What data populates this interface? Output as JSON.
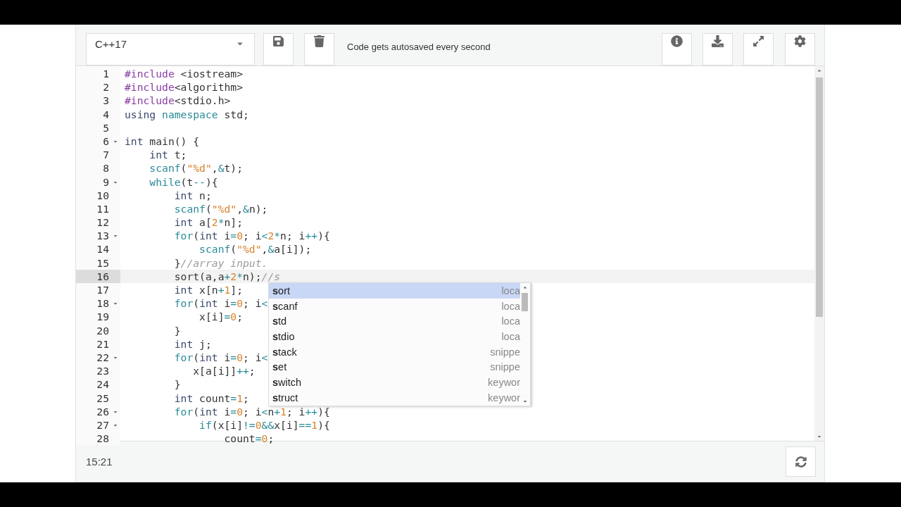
{
  "toolbar": {
    "language": "C++17",
    "note": "Code gets autosaved every second"
  },
  "editor": {
    "lines": [
      {
        "no": "1",
        "fold": false,
        "active": false,
        "tokens": [
          {
            "kind": "pre",
            "text": "#include"
          },
          {
            "kind": "tx",
            "text": " <iostream>"
          }
        ]
      },
      {
        "no": "2",
        "fold": false,
        "active": false,
        "tokens": [
          {
            "kind": "pre",
            "text": "#include"
          },
          {
            "kind": "tx",
            "text": "<algorithm>"
          }
        ]
      },
      {
        "no": "3",
        "fold": false,
        "active": false,
        "tokens": [
          {
            "kind": "pre",
            "text": "#include"
          },
          {
            "kind": "tx",
            "text": "<stdio.h>"
          }
        ]
      },
      {
        "no": "4",
        "fold": false,
        "active": false,
        "tokens": [
          {
            "kind": "kw",
            "text": "using"
          },
          {
            "kind": "fn",
            "text": " namespace"
          },
          {
            "kind": "tx",
            "text": " std;"
          }
        ]
      },
      {
        "no": "5",
        "fold": false,
        "active": false
      },
      {
        "no": "6",
        "fold": true,
        "active": false,
        "tokens": [
          {
            "kind": "kw",
            "text": "int"
          },
          {
            "kind": "tx",
            "text": " main() {"
          }
        ]
      },
      {
        "no": "7",
        "fold": false,
        "active": false,
        "tokens": [
          {
            "kind": "kw",
            "text": "    int"
          },
          {
            "kind": "tx",
            "text": " t;"
          }
        ]
      },
      {
        "no": "8",
        "fold": false,
        "active": false,
        "tokens": [
          {
            "kind": "fn",
            "text": "    scanf"
          },
          {
            "kind": "tx",
            "text": "("
          },
          {
            "kind": "str",
            "text": "\"%d\""
          },
          {
            "kind": "tx",
            "text": ","
          },
          {
            "kind": "op",
            "text": "&"
          },
          {
            "kind": "tx",
            "text": "t);"
          }
        ]
      },
      {
        "no": "9",
        "fold": true,
        "active": false,
        "tokens": [
          {
            "kind": "fn",
            "text": "    while"
          },
          {
            "kind": "tx",
            "text": "(t"
          },
          {
            "kind": "op",
            "text": "--"
          },
          {
            "kind": "tx",
            "text": "){"
          }
        ]
      },
      {
        "no": "10",
        "fold": false,
        "active": false,
        "tokens": [
          {
            "kind": "kw",
            "text": "        int"
          },
          {
            "kind": "tx",
            "text": " n;"
          }
        ]
      },
      {
        "no": "11",
        "fold": false,
        "active": false,
        "tokens": [
          {
            "kind": "fn",
            "text": "        scanf"
          },
          {
            "kind": "tx",
            "text": "("
          },
          {
            "kind": "str",
            "text": "\"%d\""
          },
          {
            "kind": "tx",
            "text": ","
          },
          {
            "kind": "op",
            "text": "&"
          },
          {
            "kind": "tx",
            "text": "n);"
          }
        ]
      },
      {
        "no": "12",
        "fold": false,
        "active": false,
        "tokens": [
          {
            "kind": "kw",
            "text": "        int"
          },
          {
            "kind": "tx",
            "text": " a["
          },
          {
            "kind": "num",
            "text": "2"
          },
          {
            "kind": "op",
            "text": "*"
          },
          {
            "kind": "tx",
            "text": "n];"
          }
        ]
      },
      {
        "no": "13",
        "fold": true,
        "active": false,
        "tokens": [
          {
            "kind": "fn",
            "text": "        for"
          },
          {
            "kind": "tx",
            "text": "("
          },
          {
            "kind": "kw",
            "text": "int"
          },
          {
            "kind": "tx",
            "text": " i"
          },
          {
            "kind": "op",
            "text": "="
          },
          {
            "kind": "num",
            "text": "0"
          },
          {
            "kind": "tx",
            "text": "; i"
          },
          {
            "kind": "op",
            "text": "<"
          },
          {
            "kind": "num",
            "text": "2"
          },
          {
            "kind": "op",
            "text": "*"
          },
          {
            "kind": "tx",
            "text": "n; i"
          },
          {
            "kind": "op",
            "text": "++"
          },
          {
            "kind": "tx",
            "text": "){"
          }
        ]
      },
      {
        "no": "14",
        "fold": false,
        "active": false,
        "tokens": [
          {
            "kind": "fn",
            "text": "            scanf"
          },
          {
            "kind": "tx",
            "text": "("
          },
          {
            "kind": "str",
            "text": "\"%d\""
          },
          {
            "kind": "tx",
            "text": ","
          },
          {
            "kind": "op",
            "text": "&"
          },
          {
            "kind": "tx",
            "text": "a[i]);"
          }
        ]
      },
      {
        "no": "15",
        "fold": false,
        "active": false,
        "tokens": [
          {
            "kind": "tx",
            "text": "        }"
          },
          {
            "kind": "cm",
            "text": "//array input."
          }
        ]
      },
      {
        "no": "16",
        "fold": false,
        "active": true,
        "tokens": [
          {
            "kind": "tx",
            "text": "        sort(a,a"
          },
          {
            "kind": "op",
            "text": "+"
          },
          {
            "kind": "num",
            "text": "2"
          },
          {
            "kind": "op",
            "text": "*"
          },
          {
            "kind": "tx",
            "text": "n);"
          },
          {
            "kind": "cm",
            "text": "//s"
          }
        ]
      },
      {
        "no": "17",
        "fold": false,
        "active": false,
        "tokens": [
          {
            "kind": "kw",
            "text": "        int"
          },
          {
            "kind": "tx",
            "text": " x[n"
          },
          {
            "kind": "op",
            "text": "+"
          },
          {
            "kind": "num",
            "text": "1"
          },
          {
            "kind": "tx",
            "text": "];"
          }
        ]
      },
      {
        "no": "18",
        "fold": true,
        "active": false,
        "tokens": [
          {
            "kind": "fn",
            "text": "        for"
          },
          {
            "kind": "tx",
            "text": "("
          },
          {
            "kind": "kw",
            "text": "int"
          },
          {
            "kind": "tx",
            "text": " i"
          },
          {
            "kind": "op",
            "text": "="
          },
          {
            "kind": "num",
            "text": "0"
          },
          {
            "kind": "tx",
            "text": "; i"
          },
          {
            "kind": "op",
            "text": "<"
          }
        ]
      },
      {
        "no": "19",
        "fold": false,
        "active": false,
        "tokens": [
          {
            "kind": "tx",
            "text": "            x[i]"
          },
          {
            "kind": "op",
            "text": "="
          },
          {
            "kind": "num",
            "text": "0"
          },
          {
            "kind": "tx",
            "text": ";"
          }
        ]
      },
      {
        "no": "20",
        "fold": false,
        "active": false,
        "tokens": [
          {
            "kind": "tx",
            "text": "        }"
          }
        ]
      },
      {
        "no": "21",
        "fold": false,
        "active": false,
        "tokens": [
          {
            "kind": "kw",
            "text": "        int"
          },
          {
            "kind": "tx",
            "text": " j;"
          }
        ]
      },
      {
        "no": "22",
        "fold": true,
        "active": false,
        "tokens": [
          {
            "kind": "fn",
            "text": "        for"
          },
          {
            "kind": "tx",
            "text": "("
          },
          {
            "kind": "kw",
            "text": "int"
          },
          {
            "kind": "tx",
            "text": " i"
          },
          {
            "kind": "op",
            "text": "="
          },
          {
            "kind": "num",
            "text": "0"
          },
          {
            "kind": "tx",
            "text": "; i"
          },
          {
            "kind": "op",
            "text": "<"
          }
        ]
      },
      {
        "no": "23",
        "fold": false,
        "active": false,
        "tokens": [
          {
            "kind": "tx",
            "text": "           x[a[i]]"
          },
          {
            "kind": "op",
            "text": "++"
          },
          {
            "kind": "tx",
            "text": ";"
          }
        ]
      },
      {
        "no": "24",
        "fold": false,
        "active": false,
        "tokens": [
          {
            "kind": "tx",
            "text": "        }"
          }
        ]
      },
      {
        "no": "25",
        "fold": false,
        "active": false,
        "tokens": [
          {
            "kind": "kw",
            "text": "        int"
          },
          {
            "kind": "tx",
            "text": " count"
          },
          {
            "kind": "op",
            "text": "="
          },
          {
            "kind": "num",
            "text": "1"
          },
          {
            "kind": "tx",
            "text": ";"
          }
        ]
      },
      {
        "no": "26",
        "fold": true,
        "active": false,
        "tokens": [
          {
            "kind": "fn",
            "text": "        for"
          },
          {
            "kind": "tx",
            "text": "("
          },
          {
            "kind": "kw",
            "text": "int"
          },
          {
            "kind": "tx",
            "text": " i"
          },
          {
            "kind": "op",
            "text": "="
          },
          {
            "kind": "num",
            "text": "0"
          },
          {
            "kind": "tx",
            "text": "; i"
          },
          {
            "kind": "op",
            "text": "<"
          },
          {
            "kind": "tx",
            "text": "n"
          },
          {
            "kind": "op",
            "text": "+"
          },
          {
            "kind": "num",
            "text": "1"
          },
          {
            "kind": "tx",
            "text": "; i"
          },
          {
            "kind": "op",
            "text": "++"
          },
          {
            "kind": "tx",
            "text": "){"
          }
        ]
      },
      {
        "no": "27",
        "fold": true,
        "active": false,
        "tokens": [
          {
            "kind": "fn",
            "text": "            if"
          },
          {
            "kind": "tx",
            "text": "(x[i]"
          },
          {
            "kind": "op",
            "text": "!="
          },
          {
            "kind": "num",
            "text": "0"
          },
          {
            "kind": "op",
            "text": "&&"
          },
          {
            "kind": "tx",
            "text": "x[i]"
          },
          {
            "kind": "op",
            "text": "=="
          },
          {
            "kind": "num",
            "text": "1"
          },
          {
            "kind": "tx",
            "text": "){"
          }
        ]
      },
      {
        "no": "28",
        "fold": false,
        "active": false,
        "tokens": [
          {
            "kind": "tx",
            "text": "                count"
          },
          {
            "kind": "op",
            "text": "="
          },
          {
            "kind": "num",
            "text": "0"
          },
          {
            "kind": "tx",
            "text": ";"
          }
        ]
      }
    ]
  },
  "autocomplete": [
    {
      "label": "**s**ort",
      "meta": "loca",
      "selected": true
    },
    {
      "label": "**s**canf",
      "meta": "loca",
      "selected": false
    },
    {
      "label": "**s**td",
      "meta": "loca",
      "selected": false
    },
    {
      "label": "**s**tdio",
      "meta": "loca",
      "selected": false
    },
    {
      "label": "**s**tack",
      "meta": "snippe",
      "selected": false
    },
    {
      "label": "**s**et",
      "meta": "snippe",
      "selected": false
    },
    {
      "label": "**s**witch",
      "meta": "keywor",
      "selected": false
    },
    {
      "label": "**s**truct",
      "meta": "keywor",
      "selected": false
    }
  ],
  "footer": {
    "time": "15:21"
  }
}
